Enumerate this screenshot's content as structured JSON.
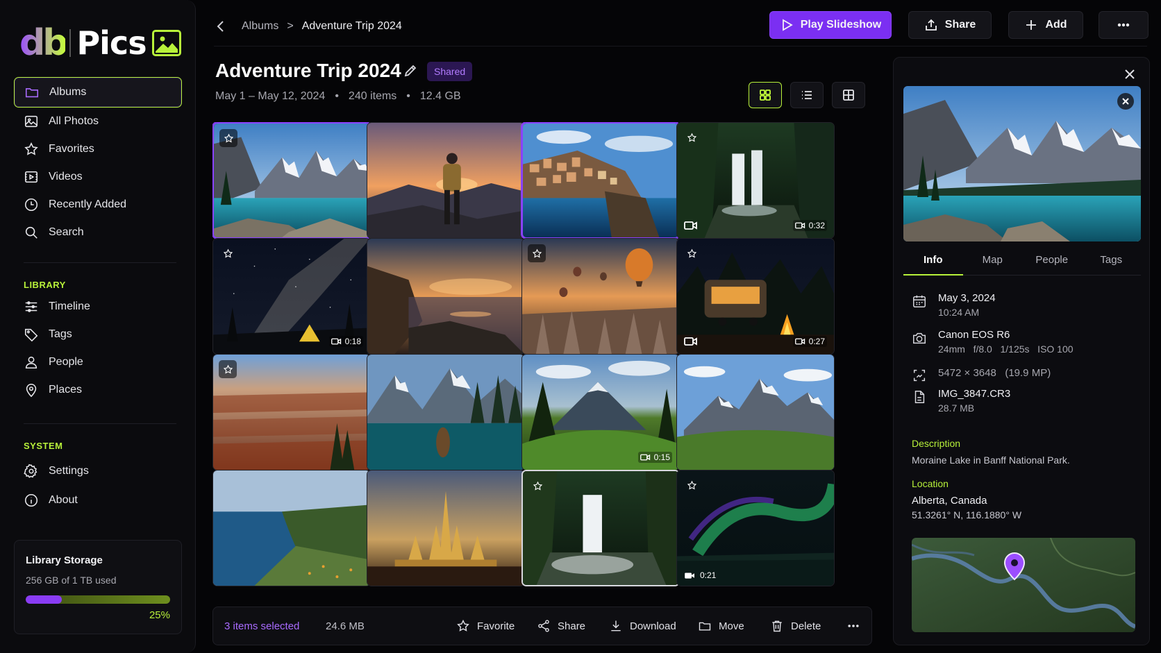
{
  "app": {
    "logo_db": "db",
    "logo_pics": "Pics"
  },
  "sidebar": {
    "main_items": [
      {
        "label": "Albums",
        "icon": "folder-icon"
      },
      {
        "label": "All Photos",
        "icon": "image-icon"
      },
      {
        "label": "Favorites",
        "icon": "star-icon"
      },
      {
        "label": "Videos",
        "icon": "video-icon"
      },
      {
        "label": "Recently Added",
        "icon": "clock-icon"
      },
      {
        "label": "Search",
        "icon": "search-icon"
      }
    ],
    "library_label": "LIBRARY",
    "library_items": [
      {
        "label": "Timeline",
        "icon": "sliders-icon"
      },
      {
        "label": "Tags",
        "icon": "tag-icon"
      },
      {
        "label": "People",
        "icon": "person-icon"
      },
      {
        "label": "Places",
        "icon": "pin-icon"
      }
    ],
    "system_label": "SYSTEM",
    "system_items": [
      {
        "label": "Settings",
        "icon": "gear-icon"
      },
      {
        "label": "About",
        "icon": "info-icon"
      }
    ],
    "storage": {
      "title": "Library Storage",
      "usage": "256 GB of 1 TB used",
      "percent_label": "25%",
      "fraction": 0.25
    }
  },
  "header": {
    "breadcrumb_parent": "Albums",
    "breadcrumb_sep": ">",
    "breadcrumb_current": "Adventure Trip 2024",
    "play_label": "Play Slideshow",
    "share_label": "Share",
    "add_label": "Add"
  },
  "album": {
    "title": "Adventure Trip 2024",
    "badge": "Shared",
    "dates": "May 1 – May 12, 2024",
    "items": "240 items",
    "size": "12.4 GB",
    "bullet": "•"
  },
  "tiles": [
    {
      "scene": "lake",
      "star": true,
      "selected": true
    },
    {
      "scene": "hiker"
    },
    {
      "scene": "cliff-town",
      "selected": true
    },
    {
      "scene": "waterfall",
      "star_plain": true,
      "video": true,
      "duration": "0:32"
    },
    {
      "scene": "milkyway",
      "star_plain": true,
      "duration": "0:18"
    },
    {
      "scene": "coast-sunset"
    },
    {
      "scene": "balloons",
      "star": true
    },
    {
      "scene": "campfire",
      "star_plain": true,
      "video": true,
      "duration": "0:27"
    },
    {
      "scene": "canyon",
      "star": true
    },
    {
      "scene": "canoe"
    },
    {
      "scene": "valley",
      "duration": "0:15"
    },
    {
      "scene": "peaks"
    },
    {
      "scene": "sea-cliffs"
    },
    {
      "scene": "temple"
    },
    {
      "scene": "forest-falls",
      "star_plain": true,
      "outlined": true
    },
    {
      "scene": "aurora",
      "star_plain": true,
      "video_left": "0:21"
    }
  ],
  "selection": {
    "count": "3 items selected",
    "size": "24.6 MB",
    "favorite": "Favorite",
    "share": "Share",
    "download": "Download",
    "move": "Move",
    "delete": "Delete"
  },
  "panel": {
    "tabs": [
      "Info",
      "Map",
      "People",
      "Tags"
    ],
    "date": "May 3, 2024",
    "time": "10:24 AM",
    "camera": "Canon EOS R6",
    "exposure": "24mm   f/8.0   1/125s   ISO 100",
    "dimensions": "5472 × 3648   (19.9 MP)",
    "filename": "IMG_3847.CR3",
    "filesize": "28.7 MB",
    "description_label": "Description",
    "description": "Moraine Lake in Banff National Park.",
    "location_label": "Location",
    "location": "Alberta, Canada",
    "coordinates": "51.3261° N, 116.1880° W"
  },
  "colors": {
    "accent_purple": "#7b2ff2",
    "accent_lime": "#b8f23a"
  }
}
